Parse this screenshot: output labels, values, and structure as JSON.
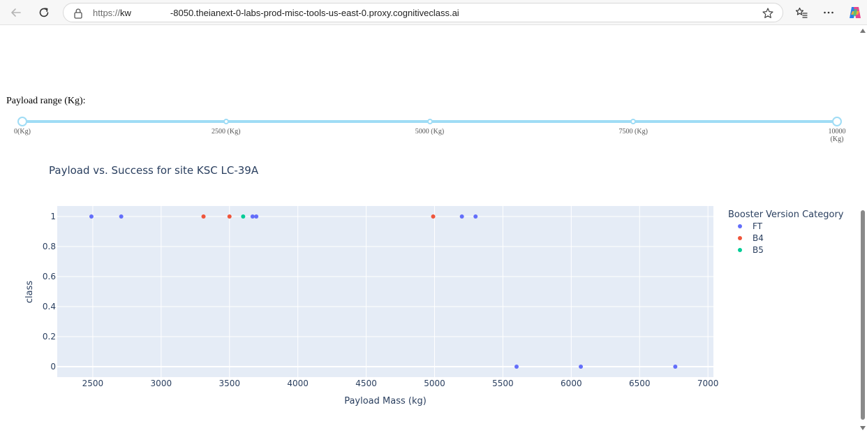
{
  "browser": {
    "url_protocol": "https://",
    "url_host_start": "kw",
    "url_host_rest": "-8050.theianext-0-labs-prod-misc-tools-us-east-0.proxy.cognitiveclass.ai",
    "icons": [
      "back-arrow-icon",
      "refresh-icon",
      "lock-icon",
      "star-icon",
      "favorites-icon",
      "more-icon",
      "copilot-icon"
    ]
  },
  "slider": {
    "label": "Payload range (Kg):",
    "min": 0,
    "max": 10000,
    "selected": [
      0,
      10000
    ],
    "marks": [
      {
        "value": 0,
        "label": "0(Kg)"
      },
      {
        "value": 2500,
        "label": "2500 (Kg)"
      },
      {
        "value": 5000,
        "label": "5000 (Kg)"
      },
      {
        "value": 7500,
        "label": "7500 (Kg)"
      },
      {
        "value": 10000,
        "label": "10000 (Kg)"
      }
    ],
    "color": "#9fdcf5"
  },
  "chart_data": {
    "type": "scatter",
    "title": "Payload vs. Success for site KSC LC-39A",
    "xlabel": "Payload Mass (kg)",
    "ylabel": "class",
    "xlim": [
      2240,
      7040
    ],
    "ylim": [
      -0.07,
      1.07
    ],
    "xticks": [
      2500,
      3000,
      3500,
      4000,
      4500,
      5000,
      5500,
      6000,
      6500,
      7000
    ],
    "yticks": [
      0,
      0.2,
      0.4,
      0.6,
      0.8,
      1
    ],
    "ytick_labels": [
      "0",
      "0.2",
      "0.4",
      "0.6",
      "0.8",
      "1"
    ],
    "grid": true,
    "legend_title": "Booster Version Category",
    "legend_position": "right",
    "plot_bg": "#e5ecf6",
    "series": [
      {
        "name": "FT",
        "color": "#636efa",
        "x": [
          2490,
          2708,
          3669,
          3696,
          5200,
          5300,
          5600,
          6070,
          6761
        ],
        "y": [
          1,
          1,
          1,
          1,
          1,
          1,
          0,
          0,
          0
        ]
      },
      {
        "name": "B4",
        "color": "#ef553b",
        "x": [
          3310,
          3500,
          4990
        ],
        "y": [
          1,
          1,
          1
        ]
      },
      {
        "name": "B5",
        "color": "#00cc96",
        "x": [
          3600
        ],
        "y": [
          1
        ]
      }
    ]
  }
}
